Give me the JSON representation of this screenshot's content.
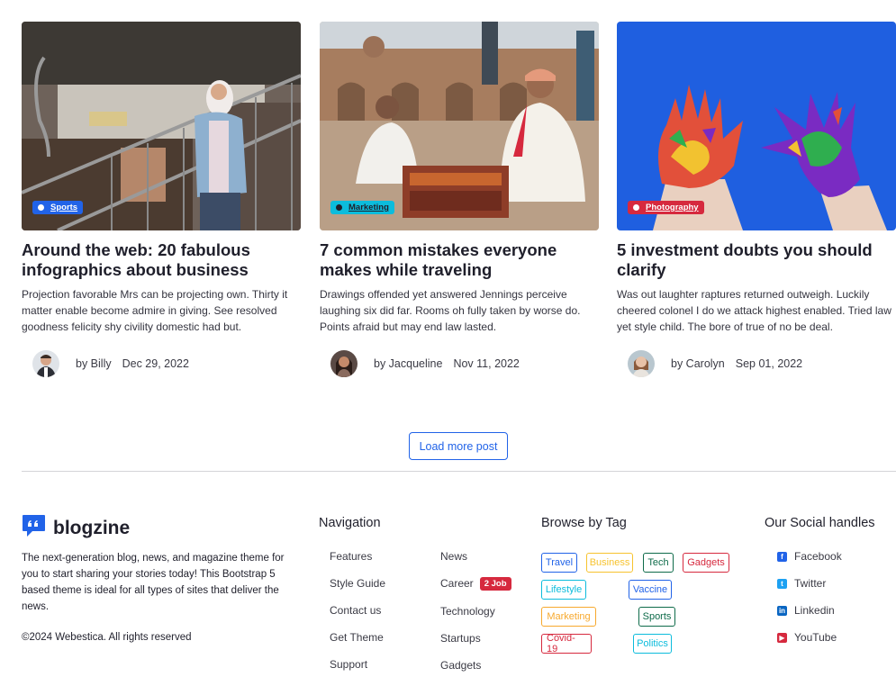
{
  "posts": [
    {
      "category": "Sports",
      "category_color": "#2163e8",
      "title": "Around the web: 20 fabulous infographics about business",
      "excerpt": "Projection favorable Mrs can be projecting own. Thirty it matter enable become admire in giving. See resolved goodness felicity shy civility domestic had but.",
      "author": "by Billy",
      "date": "Dec 29, 2022"
    },
    {
      "category": "Marketing",
      "category_color": "#0cbcdc",
      "title": "7 common mistakes everyone makes while traveling",
      "excerpt": "Drawings offended yet answered Jennings perceive laughing six did far. Rooms oh fully taken by worse do. Points afraid but may end law lasted.",
      "author": "by Jacqueline",
      "date": "Nov 11, 2022"
    },
    {
      "category": "Photography",
      "category_color": "#d6293e",
      "title": "5 investment doubts you should clarify",
      "excerpt": "Was out laughter raptures returned outweigh. Luckily cheered colonel I do we attack highest enabled. Tried law yet style child. The bore of true of no be deal.",
      "author": "by Carolyn",
      "date": "Sep 01, 2022"
    }
  ],
  "load_more_label": "Load more post",
  "footer": {
    "brand_name": "blogzine",
    "about": "The next-generation blog, news, and magazine theme for you to start sharing your stories today! This Bootstrap 5 based theme is ideal for all types of sites that deliver the news.",
    "copyright": "©2024 Webestica. All rights reserved",
    "navigation": {
      "heading": "Navigation",
      "col1": [
        "Features",
        "Style Guide",
        "Contact us",
        "Get Theme",
        "Support"
      ],
      "col2": [
        "News",
        "Career",
        "Technology",
        "Startups",
        "Gadgets"
      ],
      "career_badge": "2 Job"
    },
    "tags": {
      "heading": "Browse by Tag",
      "items": [
        {
          "label": "Travel",
          "color": "#2163e8"
        },
        {
          "label": "Business",
          "color": "#f7c32e"
        },
        {
          "label": "Tech",
          "color": "#0e6b4a"
        },
        {
          "label": "Gadgets",
          "color": "#d6293e"
        },
        {
          "label": "Lifestyle",
          "color": "#0cbcdc"
        },
        {
          "label": "Vaccine",
          "color": "#2163e8"
        },
        {
          "label": "Marketing",
          "color": "#f7a92e"
        },
        {
          "label": "Sports",
          "color": "#0e6b4a"
        },
        {
          "label": "Covid-19",
          "color": "#d6293e"
        },
        {
          "label": "Politics",
          "color": "#0cbcdc"
        }
      ]
    },
    "social": {
      "heading": "Our Social handles",
      "items": [
        {
          "label": "Facebook",
          "icon": "facebook-icon",
          "color": "#2163e8"
        },
        {
          "label": "Twitter",
          "icon": "twitter-icon",
          "color": "#1da1f2"
        },
        {
          "label": "Linkedin",
          "icon": "linkedin-icon",
          "color": "#0a66c2"
        },
        {
          "label": "YouTube",
          "icon": "youtube-icon",
          "color": "#d6293e"
        }
      ]
    }
  }
}
